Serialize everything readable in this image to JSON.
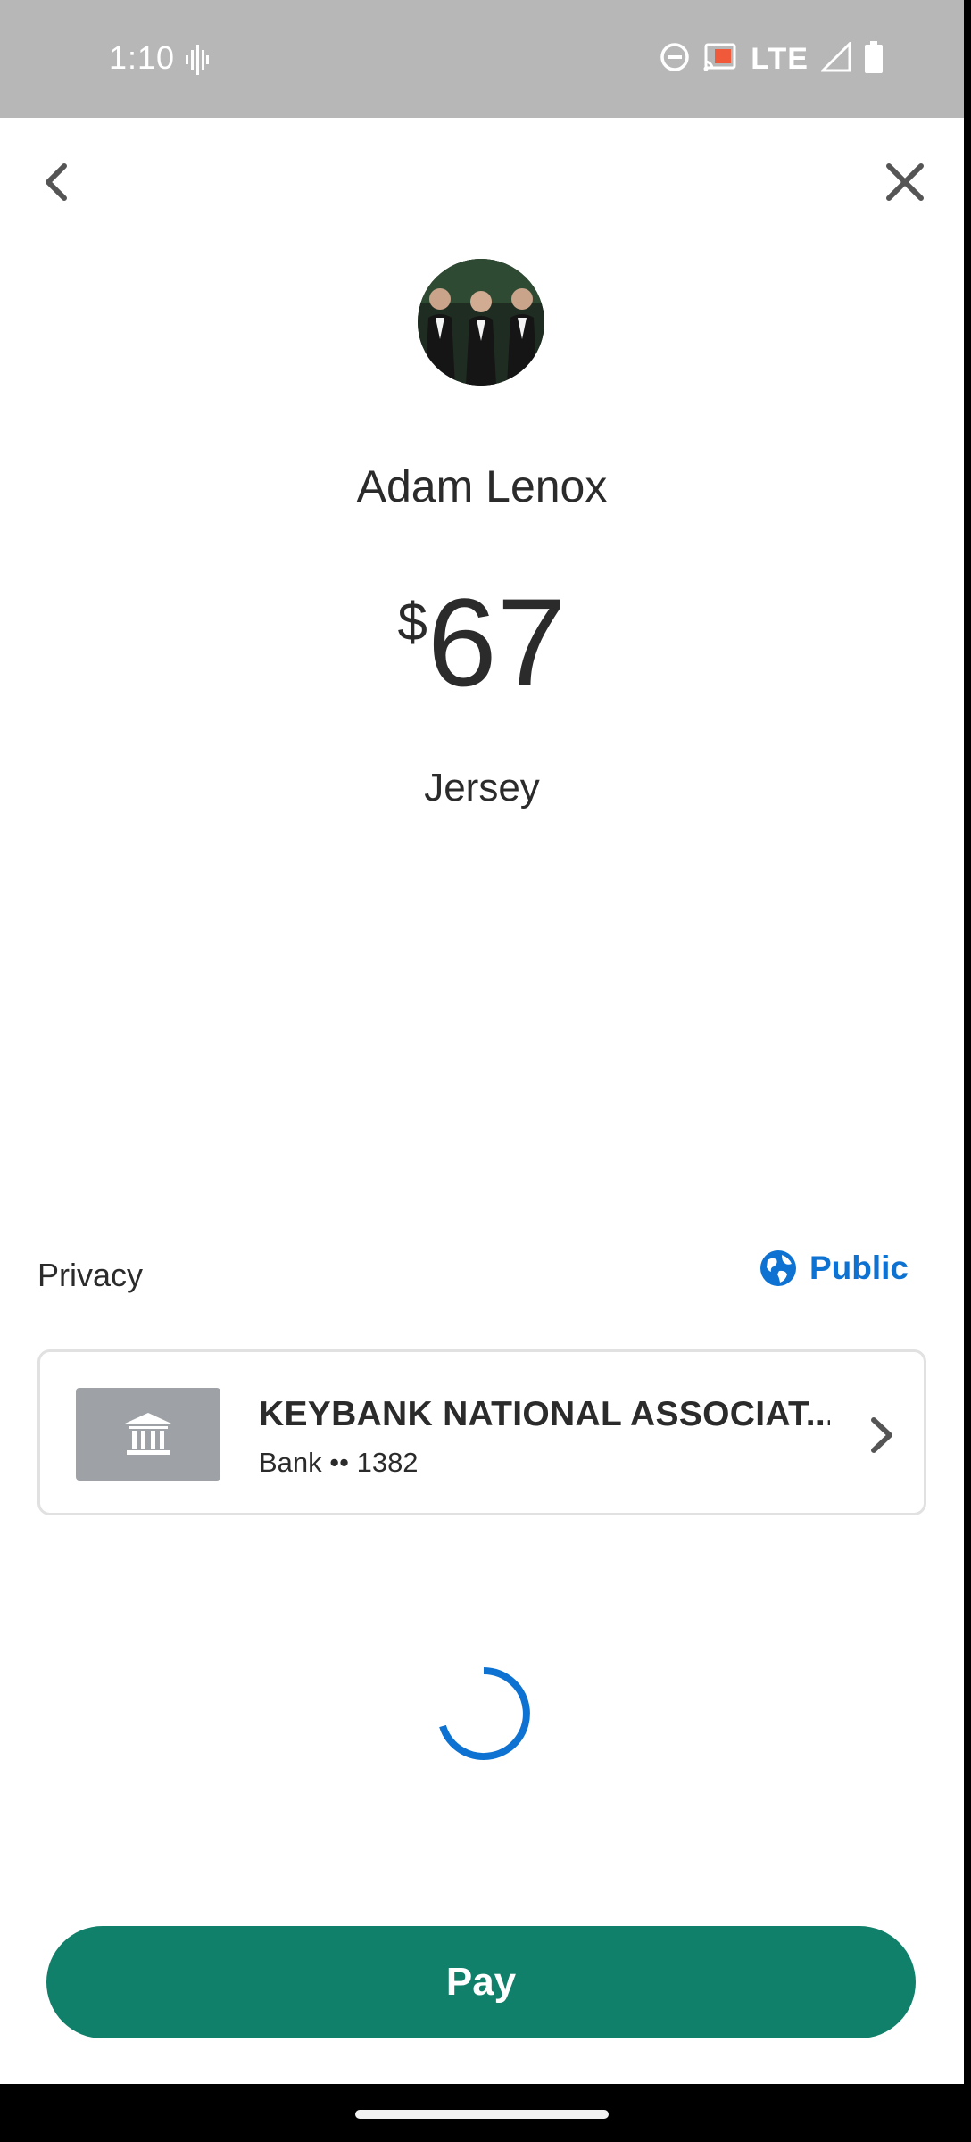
{
  "status_bar": {
    "time": "1:10",
    "network": "LTE"
  },
  "recipient": {
    "name": "Adam Lenox"
  },
  "payment": {
    "currency_symbol": "$",
    "amount": "67",
    "note": "Jersey"
  },
  "privacy": {
    "label": "Privacy",
    "value": "Public"
  },
  "funding_source": {
    "name": "KEYBANK NATIONAL ASSOCIAT...",
    "subtitle": "Bank •• 1382"
  },
  "actions": {
    "pay_label": "Pay"
  },
  "colors": {
    "accent_blue": "#0d72d1",
    "pay_green": "#11806a",
    "status_bar_gray": "#b7b7b7"
  },
  "icons": [
    "back-chevron-icon",
    "close-icon",
    "globe-icon",
    "bank-icon",
    "chevron-right-icon",
    "loading-spinner"
  ]
}
